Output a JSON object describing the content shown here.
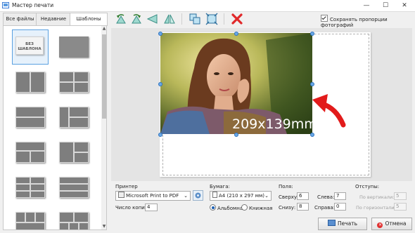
{
  "window": {
    "title": "Мастер печати",
    "minimize": "—",
    "maximize": "☐",
    "close": "✕"
  },
  "tabs": [
    {
      "label": "Все файлы",
      "active": false
    },
    {
      "label": "Недавние",
      "active": false
    },
    {
      "label": "Шаблоны",
      "active": true
    }
  ],
  "templates": {
    "first_label": "БЕЗ ШАБЛОНА",
    "selected_index": 0
  },
  "toolbar": {
    "icons": [
      "rotate-left-icon",
      "rotate-right-icon",
      "flip-horizontal-icon",
      "flip-vertical-icon",
      "copy-icon",
      "fit-icon",
      "delete-icon"
    ],
    "keep_proportions_label": "Сохранять пропорции фотографий",
    "keep_proportions_checked": true
  },
  "canvas": {
    "size_label": "209x139mm",
    "accent": "#e21b1b"
  },
  "printer": {
    "group_label": "Принтер",
    "selected": "Microsoft Print to PDF",
    "copies_label": "Число копий:",
    "copies": "4"
  },
  "paper": {
    "group_label": "Бумага:",
    "selected": "A4 (210 x 297 мм)",
    "landscape_label": "Альбомная",
    "portrait_label": "Книжная",
    "orientation": "landscape"
  },
  "margins": {
    "group_label": "Поля:",
    "top_label": "Сверху:",
    "top": "6",
    "bottom_label": "Снизу:",
    "bottom": "8",
    "left_label": "Слева:",
    "left": "7",
    "right_label": "Справа:",
    "right": "0"
  },
  "spacing": {
    "group_label": "Отступы:",
    "vertical_label": "По вертикали:",
    "vertical": "5",
    "horizontal_label": "По горизонтали:",
    "horizontal": "5"
  },
  "actions": {
    "print_label": "Печать",
    "cancel_label": "Отмена"
  }
}
